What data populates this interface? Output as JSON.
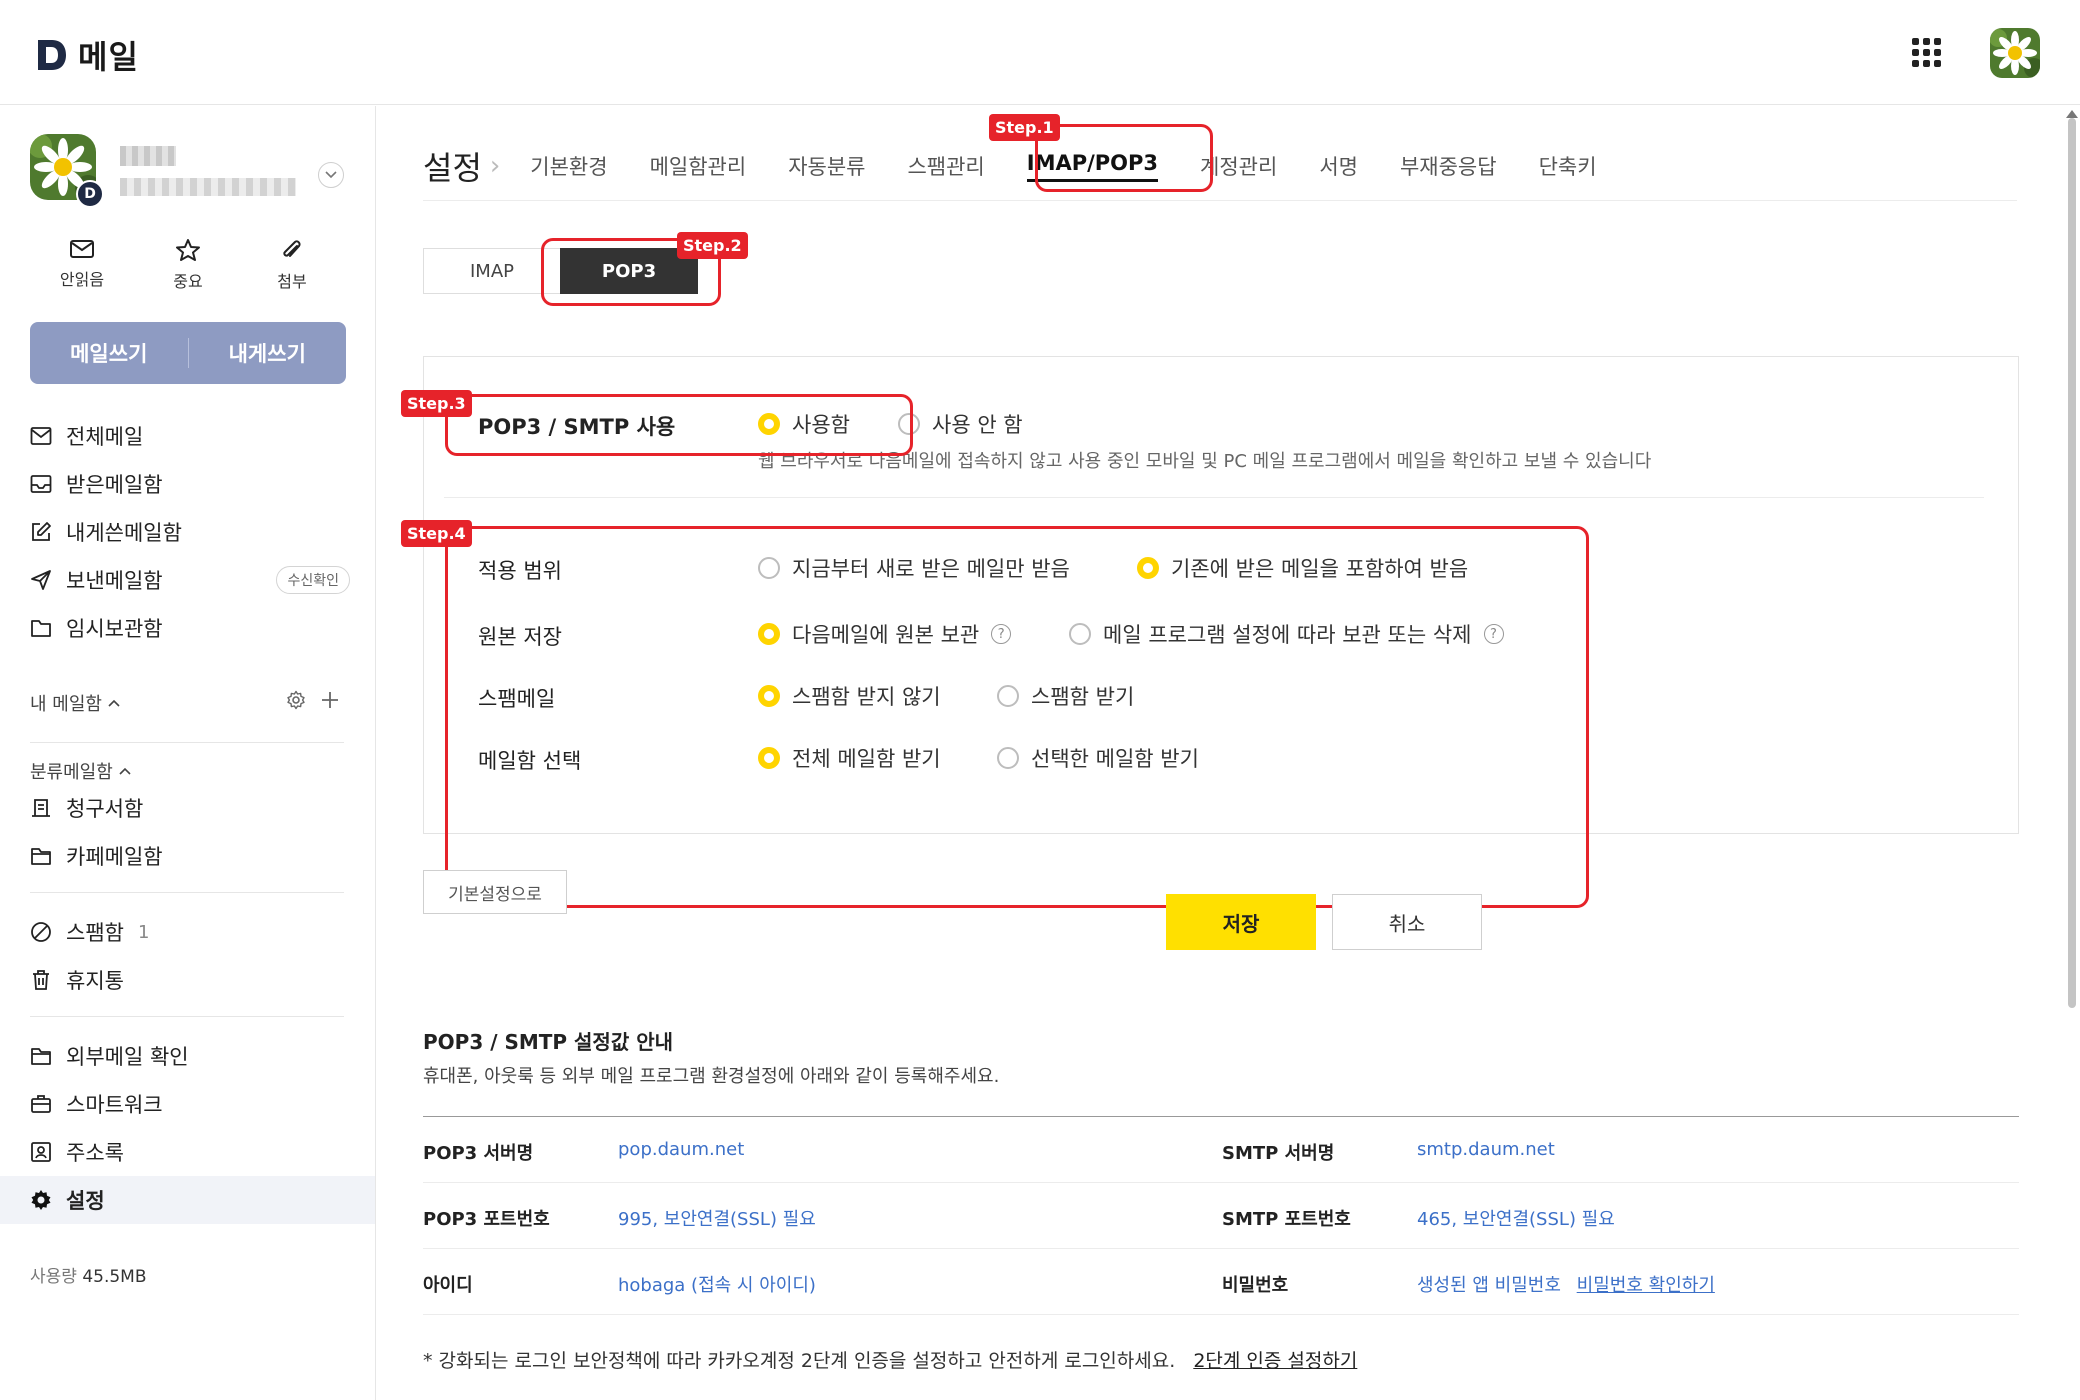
{
  "app": {
    "logo_text": "메일",
    "logo_mark": "D"
  },
  "colors": {
    "accent_yellow": "#ffe000",
    "compose_bg": "#8e9bc2",
    "step_red": "#e6232a",
    "link_blue": "#3c70c8"
  },
  "header": {
    "apps_icon": "grid-icon",
    "avatar": "daisy-avatar"
  },
  "profile": {
    "badge": "D"
  },
  "quick_actions": [
    {
      "label": "안읽음",
      "icon": "envelope-icon"
    },
    {
      "label": "중요",
      "icon": "star-icon"
    },
    {
      "label": "첨부",
      "icon": "paperclip-icon"
    }
  ],
  "compose": {
    "write": "메일쓰기",
    "self": "내게쓰기"
  },
  "nav": {
    "all": "전체메일",
    "inbox": "받은메일함",
    "tome": "내게쓴메일함",
    "sent": "보낸메일함",
    "sent_badge": "수신확인",
    "drafts": "임시보관함",
    "my_mailbox": "내 메일함",
    "category": "분류메일함",
    "bills": "청구서함",
    "cafe": "카페메일함",
    "spam": "스팸함",
    "spam_count": "1",
    "trash": "휴지통",
    "external": "외부메일 확인",
    "smartwork": "스마트워크",
    "contacts": "주소록",
    "settings": "설정"
  },
  "usage": {
    "label": "사용량",
    "value": "45.5MB"
  },
  "settings": {
    "title": "설정",
    "tabs": [
      "기본환경",
      "메일함관리",
      "자동분류",
      "스팸관리",
      "IMAP/POP3",
      "계정관리",
      "서명",
      "부재중응답",
      "단축키"
    ],
    "active_tab": "IMAP/POP3",
    "segments": {
      "imap": "IMAP",
      "pop3": "POP3"
    }
  },
  "steps": {
    "s1": "Step.1",
    "s2": "Step.2",
    "s3": "Step.3",
    "s4": "Step.4"
  },
  "pop3": {
    "use_label": "POP3 / SMTP 사용",
    "use_on": "사용함",
    "use_off": "사용 안 함",
    "use_desc": "웹 브라우저로 다음메일에 접속하지 않고 사용 중인 모바일 및 PC 메일 프로그램에서 메일을 확인하고 보낼 수 있습니다",
    "scope_label": "적용 범위",
    "scope_new": "지금부터 새로 받은 메일만 받음",
    "scope_all": "기존에 받은 메일을 포함하여 받음",
    "orig_label": "원본 저장",
    "orig_keep": "다음메일에 원본 보관",
    "orig_follow": "메일 프로그램 설정에 따라 보관 또는 삭제",
    "spam_label": "스팸메일",
    "spam_no": "스팸함 받지 않기",
    "spam_yes": "스팸함 받기",
    "box_label": "메일함 선택",
    "box_all": "전체 메일함 받기",
    "box_sel": "선택한 메일함 받기"
  },
  "buttons": {
    "reset": "기본설정으로",
    "save": "저장",
    "cancel": "취소"
  },
  "guide": {
    "title": "POP3 / SMTP 설정값 안내",
    "subtitle": "휴대폰, 아웃룩 등 외부 메일 프로그램 환경설정에 아래와 같이 등록해주세요.",
    "pop3_server_k": "POP3 서버명",
    "pop3_server_v": "pop.daum.net",
    "smtp_server_k": "SMTP 서버명",
    "smtp_server_v": "smtp.daum.net",
    "pop3_port_k": "POP3 포트번호",
    "pop3_port_v": "995, 보안연결(SSL) 필요",
    "smtp_port_k": "SMTP 포트번호",
    "smtp_port_v": "465, 보안연결(SSL) 필요",
    "id_k": "아이디",
    "id_v": "hobaga (접속 시 아이디)",
    "pw_k": "비밀번호",
    "pw_v": "생성된 앱 비밀번호",
    "pw_link": "비밀번호 확인하기",
    "footnote": "* 강화되는 로그인 보안정책에 따라 카카오계정 2단계 인증을 설정하고 안전하게 로그인하세요.",
    "footnote_link": "2단계 인증 설정하기"
  }
}
